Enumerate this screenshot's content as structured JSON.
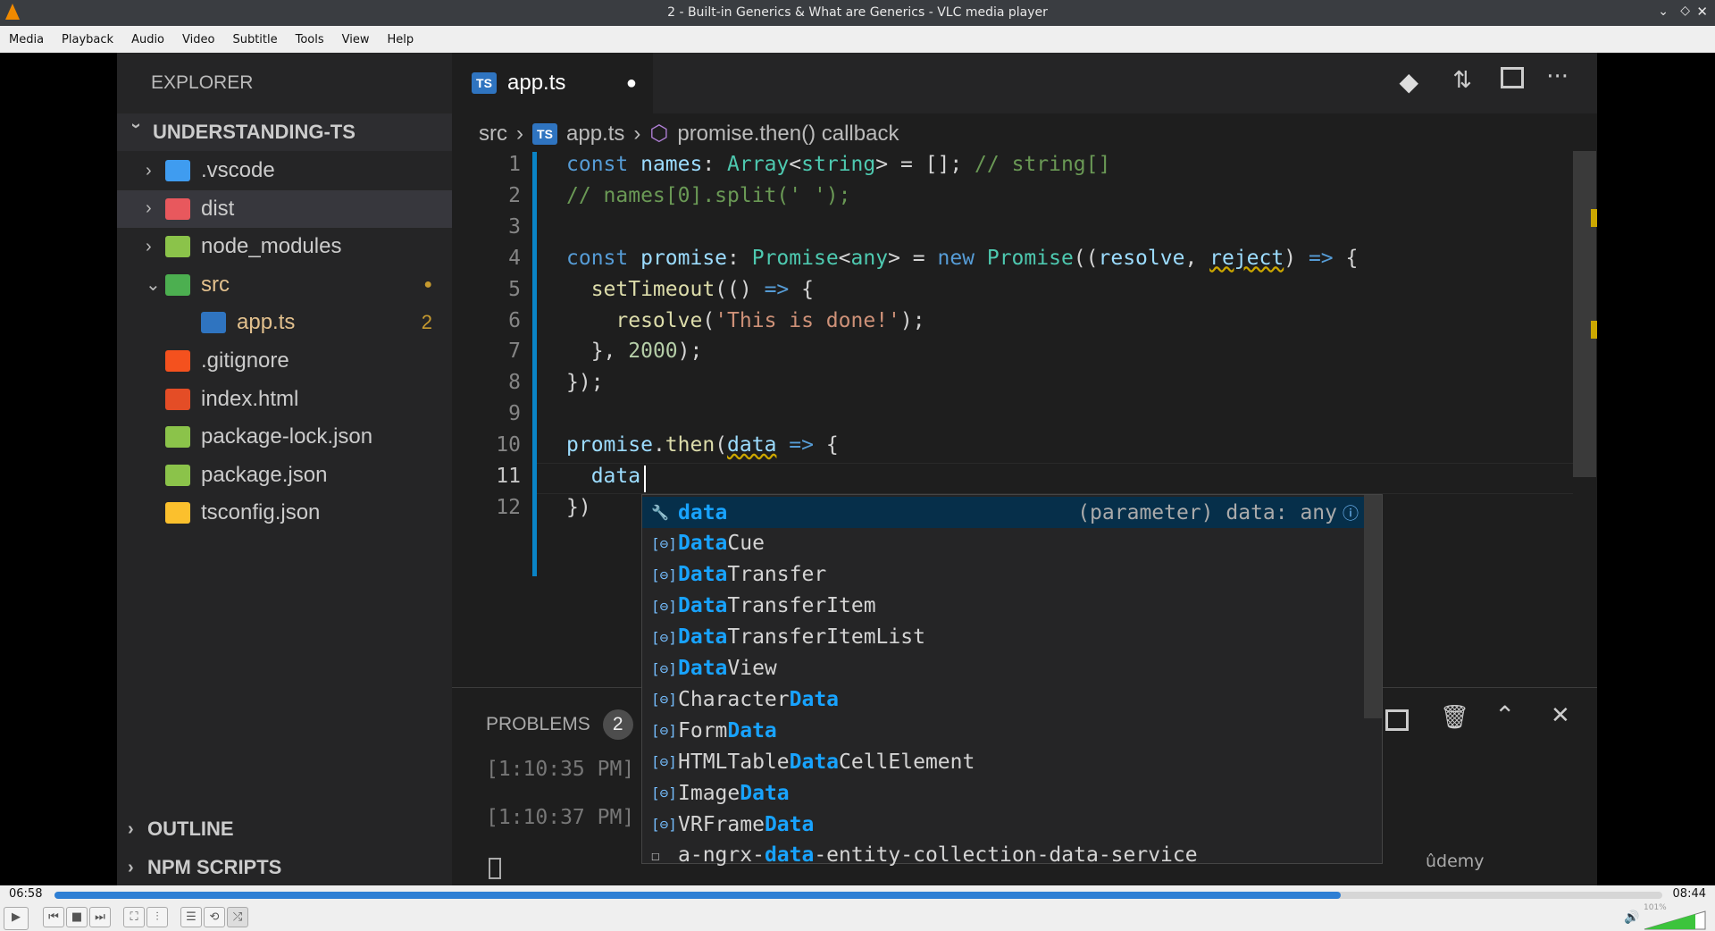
{
  "window": {
    "title": "2 - Built-in Generics & What are Generics - VLC media player"
  },
  "menu": [
    "Media",
    "Playback",
    "Audio",
    "Video",
    "Subtitle",
    "Tools",
    "View",
    "Help"
  ],
  "explorer": {
    "header": "EXPLORER",
    "project": "UNDERSTANDING-TS",
    "items": [
      {
        "label": ".vscode",
        "icon": "vscode-folder-icon",
        "color": "#3f9cf0",
        "chev": "›",
        "indent": 1
      },
      {
        "label": "dist",
        "icon": "folder-icon",
        "color": "#e8585d",
        "chev": "›",
        "indent": 1
      },
      {
        "label": "node_modules",
        "icon": "node-folder-icon",
        "color": "#8bc34a",
        "chev": "›",
        "indent": 1
      },
      {
        "label": "src",
        "icon": "src-folder-icon",
        "color": "#4caf50",
        "chev": "⌄",
        "indent": 1,
        "badge": "●"
      },
      {
        "label": "app.ts",
        "icon": "typescript-icon",
        "color": "#2f74c0",
        "indent": 2,
        "badge": "2"
      },
      {
        "label": ".gitignore",
        "icon": "git-icon",
        "color": "#f4511e",
        "indent": 1
      },
      {
        "label": "index.html",
        "icon": "html-icon",
        "color": "#e44d26",
        "indent": 1
      },
      {
        "label": "package-lock.json",
        "icon": "npm-icon",
        "color": "#8bc34a",
        "indent": 1
      },
      {
        "label": "package.json",
        "icon": "npm-icon",
        "color": "#8bc34a",
        "indent": 1
      },
      {
        "label": "tsconfig.json",
        "icon": "json-icon",
        "color": "#fbc02d",
        "indent": 1
      }
    ],
    "outline": "OUTLINE",
    "npm_scripts": "NPM SCRIPTS"
  },
  "tab": {
    "label": "app.ts",
    "modified": "●"
  },
  "breadcrumb": [
    "src",
    "app.ts",
    "promise.then() callback"
  ],
  "code": [
    [
      [
        "const ",
        "kw"
      ],
      [
        "names",
        "v"
      ],
      [
        ": ",
        "p"
      ],
      [
        "Array",
        "ty"
      ],
      [
        "<",
        "p"
      ],
      [
        "string",
        "ty"
      ],
      [
        "> = []; ",
        "p"
      ],
      [
        "// string[]",
        "cm"
      ]
    ],
    [
      [
        "// names[0].split(' ');",
        "cm"
      ]
    ],
    [],
    [
      [
        "const ",
        "kw"
      ],
      [
        "promise",
        "v"
      ],
      [
        ": ",
        "p"
      ],
      [
        "Promise",
        "ty"
      ],
      [
        "<",
        "p"
      ],
      [
        "any",
        "ty"
      ],
      [
        "> = ",
        "p"
      ],
      [
        "new ",
        "kw"
      ],
      [
        "Promise",
        "ty"
      ],
      [
        "((",
        "p"
      ],
      [
        "resolve",
        "v"
      ],
      [
        ", ",
        "p"
      ],
      [
        "reject",
        "v sq"
      ],
      [
        ") ",
        "p"
      ],
      [
        "=>",
        "kw"
      ],
      [
        " {",
        "p"
      ]
    ],
    [
      [
        "  setTimeout",
        "fn"
      ],
      [
        "(() ",
        "p"
      ],
      [
        "=>",
        "kw"
      ],
      [
        " {",
        "p"
      ]
    ],
    [
      [
        "    resolve",
        "fn"
      ],
      [
        "(",
        "p"
      ],
      [
        "'This is done!'",
        "st"
      ],
      [
        ");",
        "p"
      ]
    ],
    [
      [
        "  }, ",
        "p"
      ],
      [
        "2000",
        "nu"
      ],
      [
        ");",
        "p"
      ]
    ],
    [
      [
        "});",
        "p"
      ]
    ],
    [],
    [
      [
        "promise",
        "v"
      ],
      [
        ".",
        "p"
      ],
      [
        "then",
        "fn"
      ],
      [
        "(",
        "p"
      ],
      [
        "data",
        "v sq"
      ],
      [
        " ",
        "p"
      ],
      [
        "=>",
        "kw"
      ],
      [
        " {",
        "p"
      ]
    ],
    [
      [
        "  data",
        "v"
      ]
    ],
    [
      [
        "})",
        "p"
      ]
    ]
  ],
  "autocomplete": {
    "detail": "(parameter) data: any",
    "items": [
      [
        "",
        "data",
        ""
      ],
      [
        "",
        "Data",
        "Cue"
      ],
      [
        "",
        "Data",
        "Transfer"
      ],
      [
        "",
        "Data",
        "TransferItem"
      ],
      [
        "",
        "Data",
        "TransferItemList"
      ],
      [
        "",
        "Data",
        "View"
      ],
      [
        "Character",
        "Data",
        ""
      ],
      [
        "Form",
        "Data",
        ""
      ],
      [
        "HTMLTable",
        "Data",
        "CellElement"
      ],
      [
        "Image",
        "Data",
        ""
      ],
      [
        "VRFrame",
        "Data",
        ""
      ],
      [
        "a-ngrx-",
        "data",
        "-entity-collection-data-service"
      ]
    ]
  },
  "panel": {
    "tab": "PROBLEMS",
    "count": "2",
    "lines": [
      "[1:10:35 PM]",
      "[1:10:37 PM]"
    ]
  },
  "watermark": "ûdemy",
  "player": {
    "elapsed": "06:58",
    "total": "08:44",
    "progress": 0.8,
    "volume": "101%"
  }
}
